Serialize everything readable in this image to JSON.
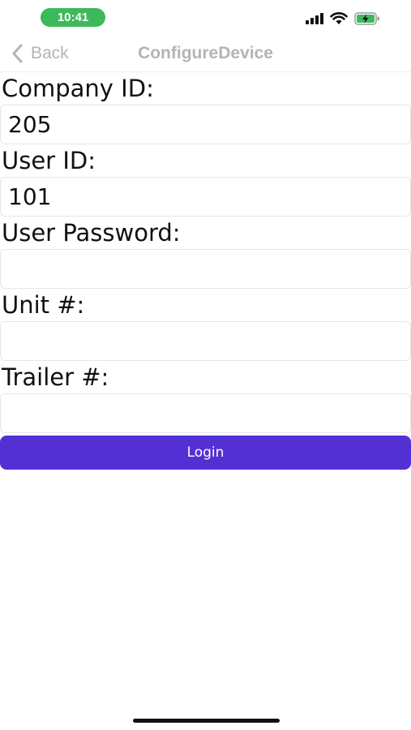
{
  "status_bar": {
    "time": "10:41",
    "icons": [
      "cellular-signal-icon",
      "wifi-icon",
      "battery-charging-icon"
    ],
    "time_pill_color": "#3cb95a"
  },
  "nav": {
    "back_label": "Back",
    "title": "ConfigureDevice",
    "tint_color": "#b4b4b4"
  },
  "form": {
    "company_id": {
      "label": "Company ID:",
      "value": "205"
    },
    "user_id": {
      "label": "User ID:",
      "value": "101"
    },
    "user_password": {
      "label": "User Password:",
      "value": ""
    },
    "unit": {
      "label": "Unit #:",
      "value": ""
    },
    "trailer": {
      "label": "Trailer #:",
      "value": ""
    },
    "login_label": "Login",
    "accent_color": "#5330d4"
  }
}
